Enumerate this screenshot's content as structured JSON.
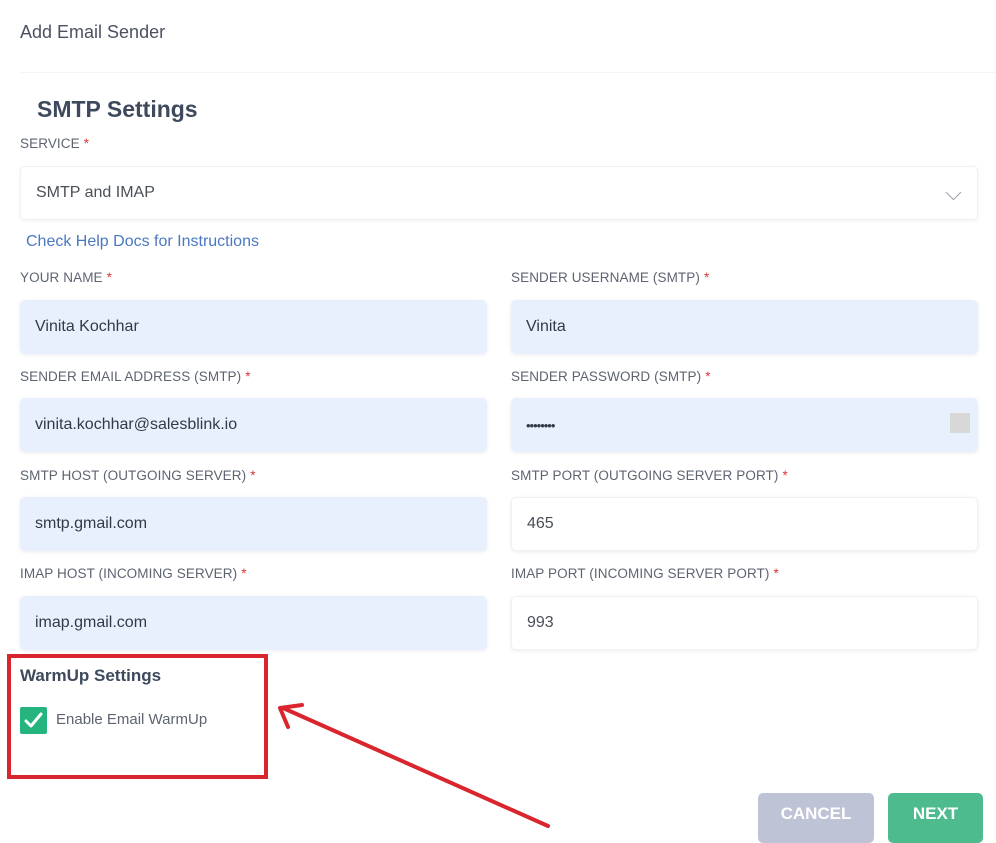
{
  "modal": {
    "title": "Add Email Sender"
  },
  "smtp": {
    "section_title": "SMTP Settings",
    "service": {
      "label": "SERVICE",
      "required": "*",
      "value": "SMTP and IMAP"
    },
    "help_link": "Check Help Docs for Instructions",
    "fields": {
      "your_name": {
        "label": "YOUR NAME",
        "required": "*",
        "value": "Vinita Kochhar"
      },
      "sender_username": {
        "label": "SENDER USERNAME (SMTP)",
        "required": "*",
        "value": "Vinita"
      },
      "sender_email": {
        "label": "SENDER EMAIL ADDRESS (SMTP)",
        "required": "*",
        "value": "vinita.kochhar@salesblink.io"
      },
      "sender_password": {
        "label": "SENDER PASSWORD (SMTP)",
        "required": "*",
        "value": "••••••••"
      },
      "smtp_host": {
        "label": "SMTP HOST (OUTGOING SERVER)",
        "required": "*",
        "value": "smtp.gmail.com"
      },
      "smtp_port": {
        "label": "SMTP PORT (OUTGOING SERVER PORT)",
        "required": "*",
        "value": "465"
      },
      "imap_host": {
        "label": "IMAP HOST (INCOMING SERVER)",
        "required": "*",
        "value": "imap.gmail.com"
      },
      "imap_port": {
        "label": "IMAP PORT (INCOMING SERVER PORT)",
        "required": "*",
        "value": "993"
      }
    }
  },
  "warmup": {
    "section_title": "WarmUp Settings",
    "checkbox_label": "Enable Email WarmUp",
    "checked": true
  },
  "actions": {
    "cancel_label": "CANCEL",
    "next_label": "NEXT"
  },
  "annotation": {
    "color": "#d9262e"
  }
}
